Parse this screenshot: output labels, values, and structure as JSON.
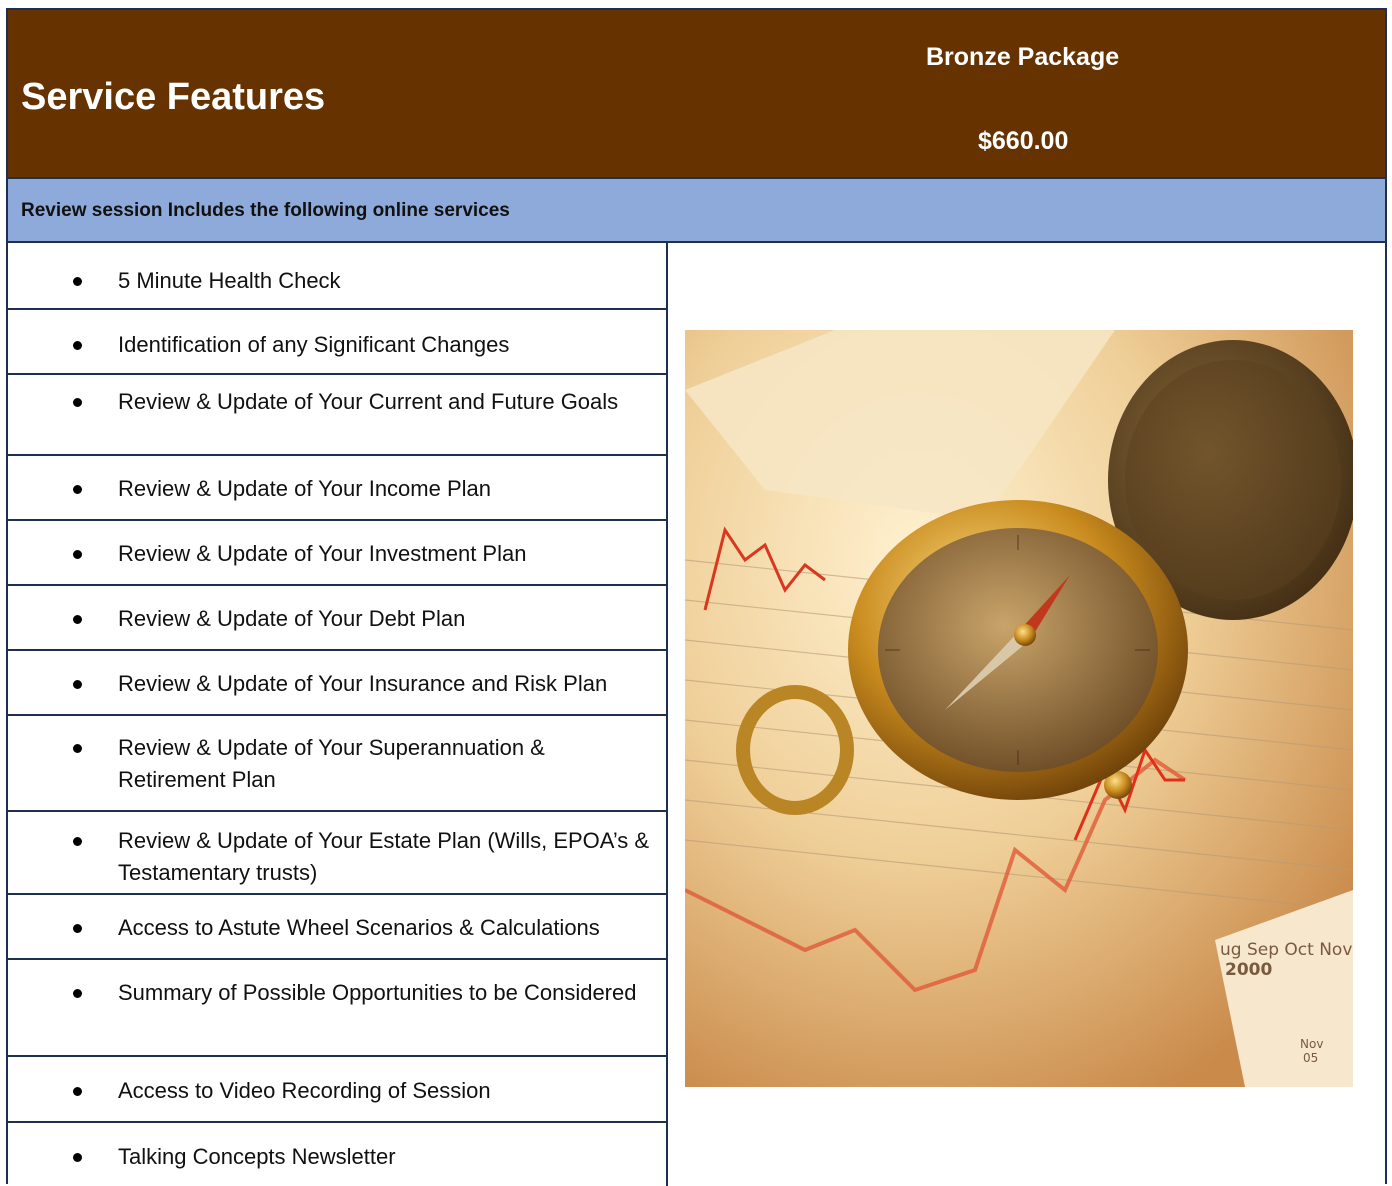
{
  "header": {
    "title": "Service Features",
    "package_name": "Bronze Package",
    "price": "$660.00"
  },
  "subheader": {
    "text": "Review session Includes the following online services"
  },
  "features": [
    "5 Minute Health Check",
    "Identification of any Significant Changes",
    "Review & Update of Your Current and Future Goals",
    "Review & Update of Your Income Plan",
    "Review & Update of Your Investment Plan",
    "Review & Update of Your Debt Plan",
    "Review & Update of Your Insurance and Risk Plan",
    "Review & Update of Your Superannuation & Retirement Plan",
    "Review & Update of Your Estate Plan (Wills, EPOA’s & Testamentary trusts)",
    "Access to Astute Wheel Scenarios & Calculations",
    "Summary of Possible Opportunities to be Considered",
    "Access to Video Recording of Session",
    "Talking Concepts Newsletter"
  ],
  "photo": {
    "chart_labels": [
      "ug Sep Oct Nov De",
      "2000",
      "Nov",
      "05"
    ]
  },
  "colors": {
    "header_bg": "#663300",
    "subheader_bg": "#8eaadb",
    "border": "#1f2f4f"
  }
}
